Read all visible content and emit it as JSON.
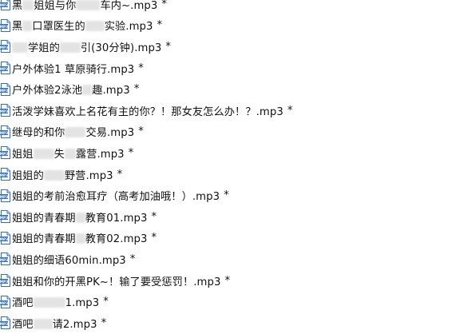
{
  "modified_marker": "*",
  "icon": {
    "name": "mp3-file-icon",
    "accent": "#2f6fc7",
    "label": "MP3"
  },
  "files": [
    {
      "parts": [
        "黑",
        {
          "blur": 14
        },
        "姐姐与你",
        {
          "blur": 30
        },
        "车内~.mp3"
      ]
    },
    {
      "parts": [
        "黑",
        {
          "blur": 12
        },
        "口罩医生的",
        {
          "blur": 24
        },
        "实验.mp3"
      ]
    },
    {
      "parts": [
        {
          "blur": 20
        },
        "学姐的",
        {
          "blur": 26
        },
        "引(30分钟).mp3"
      ]
    },
    {
      "parts": [
        "户外体验1 草原骑行.mp3"
      ]
    },
    {
      "parts": [
        "户外体验2泳池",
        {
          "blur": 12
        },
        "趣.mp3"
      ]
    },
    {
      "parts": [
        "活泼学妹喜欢上名花有主的你？！那女友怎么办！？.mp3"
      ]
    },
    {
      "parts": [
        "继母的和你",
        {
          "blur": 26
        },
        "交易.mp3"
      ]
    },
    {
      "parts": [
        "姐姐",
        {
          "blur": 26
        },
        "失",
        {
          "blur": 14
        },
        "露营.mp3"
      ]
    },
    {
      "parts": [
        "姐姐的",
        {
          "blur": 26
        },
        "野营.mp3"
      ]
    },
    {
      "parts": [
        "姐姐的考前治愈耳疗（高考加油哦！）.mp3"
      ]
    },
    {
      "parts": [
        "姐姐的青春期",
        {
          "blur": 12
        },
        "教育01.mp3"
      ]
    },
    {
      "parts": [
        "姐姐的青春期",
        {
          "blur": 12
        },
        "教育02.mp3"
      ]
    },
    {
      "parts": [
        "姐姐的细语60min.mp3"
      ]
    },
    {
      "parts": [
        "姐姐和你的开黑PK~！输了要受惩罚！.mp3"
      ]
    },
    {
      "parts": [
        "酒吧",
        {
          "blur": 40
        },
        "1.mp3"
      ]
    },
    {
      "parts": [
        "酒吧",
        {
          "blur": 24
        },
        "请2.mp3"
      ]
    }
  ]
}
